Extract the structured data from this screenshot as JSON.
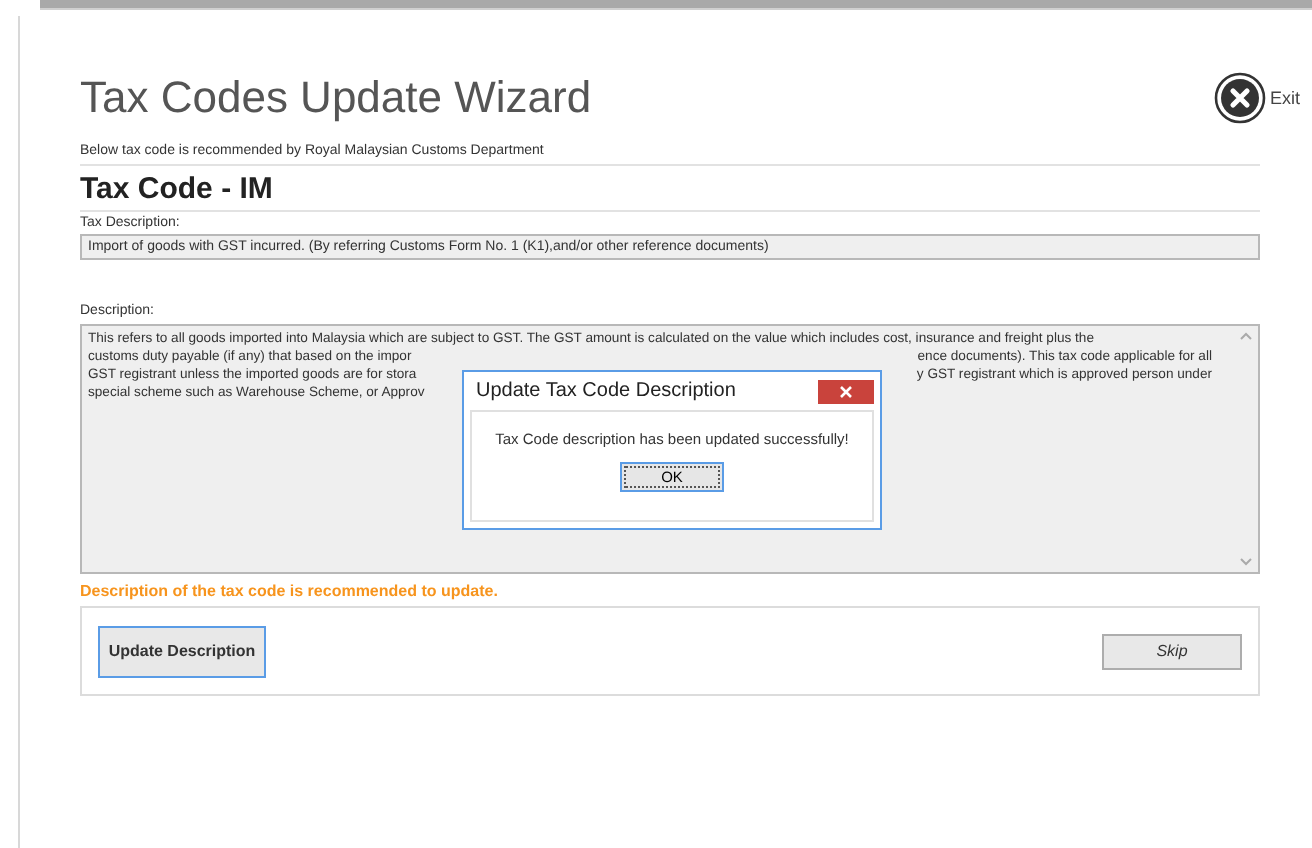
{
  "wizard": {
    "title": "Tax Codes Update Wizard",
    "exit_label": "Exit",
    "recommendation": "Below tax code is recommended by Royal Malaysian Customs Department",
    "tax_code_heading": "Tax Code - IM",
    "tax_description_label": "Tax Description:",
    "tax_description_value": "Import of goods with GST incurred. (By referring Customs Form No. 1 (K1),and/or other reference documents)",
    "description_label": "Description:",
    "description_lines": [
      {
        "left": "This refers to all goods imported into Malaysia which are subject to GST. The GST amount is calculated on the value which includes cost, insurance and freight plus the"
      },
      {
        "left": "customs duty payable (if any) that based on the impor",
        "right": "ence documents). This tax code applicable for all"
      },
      {
        "left": "GST registrant unless the imported goods are for stora",
        "right": "y GST registrant which is approved person under"
      },
      {
        "left": "special scheme such as Warehouse Scheme, or Approv"
      }
    ],
    "warning": "Description of the tax code is recommended to update.",
    "buttons": [
      {
        "label": "Update Description",
        "kind": "primary"
      },
      {
        "label": "Skip",
        "kind": "secondary"
      }
    ]
  },
  "dialog": {
    "title": "Update Tax Code Description",
    "message": "Tax Code description has been updated successfully!",
    "button": "OK"
  }
}
